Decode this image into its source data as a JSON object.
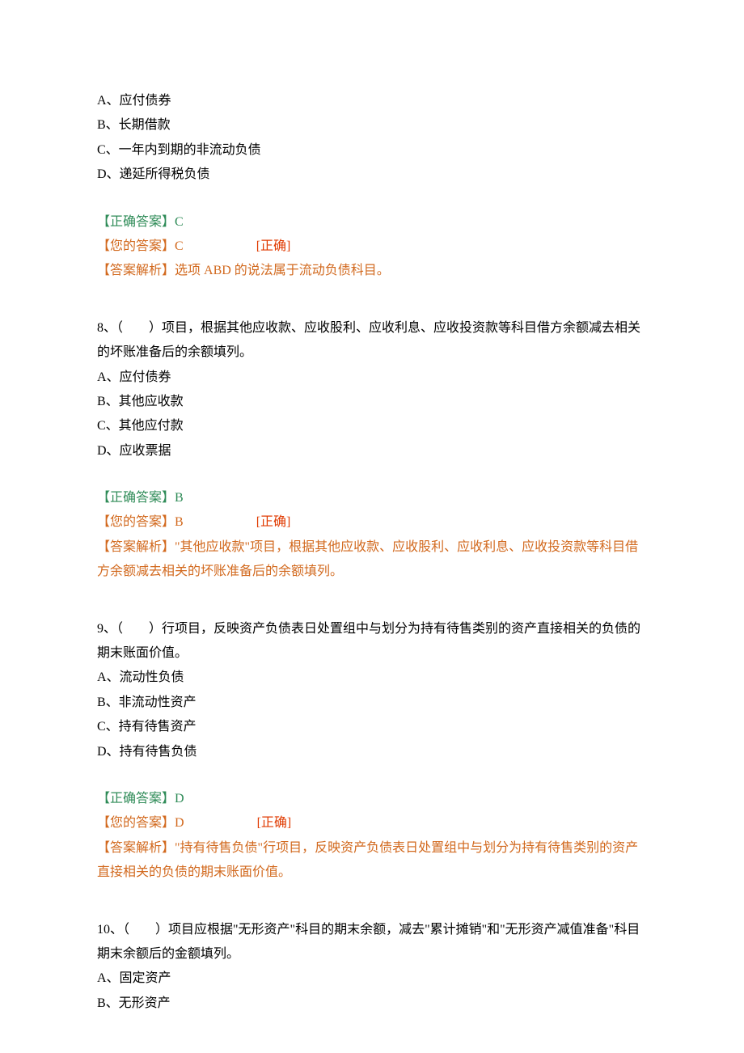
{
  "q7": {
    "options": {
      "a": "A、应付债券",
      "b": "B、长期借款",
      "c": "C、一年内到期的非流动负债",
      "d": "D、递延所得税负债"
    },
    "correct_label": "【正确答案】",
    "correct_value": "C",
    "your_label": "【您的答案】",
    "your_value": "C",
    "status": "[正确]",
    "analysis_label": "【答案解析】",
    "analysis_text": "选项 ABD 的说法属于流动负债科目。"
  },
  "q8": {
    "stem": "8、（　　）项目，根据其他应收款、应收股利、应收利息、应收投资款等科目借方余额减去相关的坏账准备后的余额填列。",
    "options": {
      "a": "A、应付债券",
      "b": "B、其他应收款",
      "c": "C、其他应付款",
      "d": "D、应收票据"
    },
    "correct_label": "【正确答案】",
    "correct_value": "B",
    "your_label": "【您的答案】",
    "your_value": "B",
    "status": "[正确]",
    "analysis_label": "【答案解析】",
    "analysis_text": "\"其他应收款\"项目，根据其他应收款、应收股利、应收利息、应收投资款等科目借方余额减去相关的坏账准备后的余额填列。"
  },
  "q9": {
    "stem": "9、（　　）行项目，反映资产负债表日处置组中与划分为持有待售类别的资产直接相关的负债的期末账面价值。",
    "options": {
      "a": "A、流动性负债",
      "b": "B、非流动性资产",
      "c": "C、持有待售资产",
      "d": "D、持有待售负债"
    },
    "correct_label": "【正确答案】",
    "correct_value": "D",
    "your_label": "【您的答案】",
    "your_value": "D",
    "status": "[正确]",
    "analysis_label": "【答案解析】",
    "analysis_text": "\"持有待售负债\"行项目，反映资产负债表日处置组中与划分为持有待售类别的资产直接相关的负债的期末账面价值。"
  },
  "q10": {
    "stem": "10、（　　）项目应根据\"无形资产\"科目的期末余额，减去\"累计摊销\"和\"无形资产减值准备\"科目期末余额后的金额填列。",
    "options": {
      "a": "A、固定资产",
      "b": "B、无形资产"
    }
  }
}
